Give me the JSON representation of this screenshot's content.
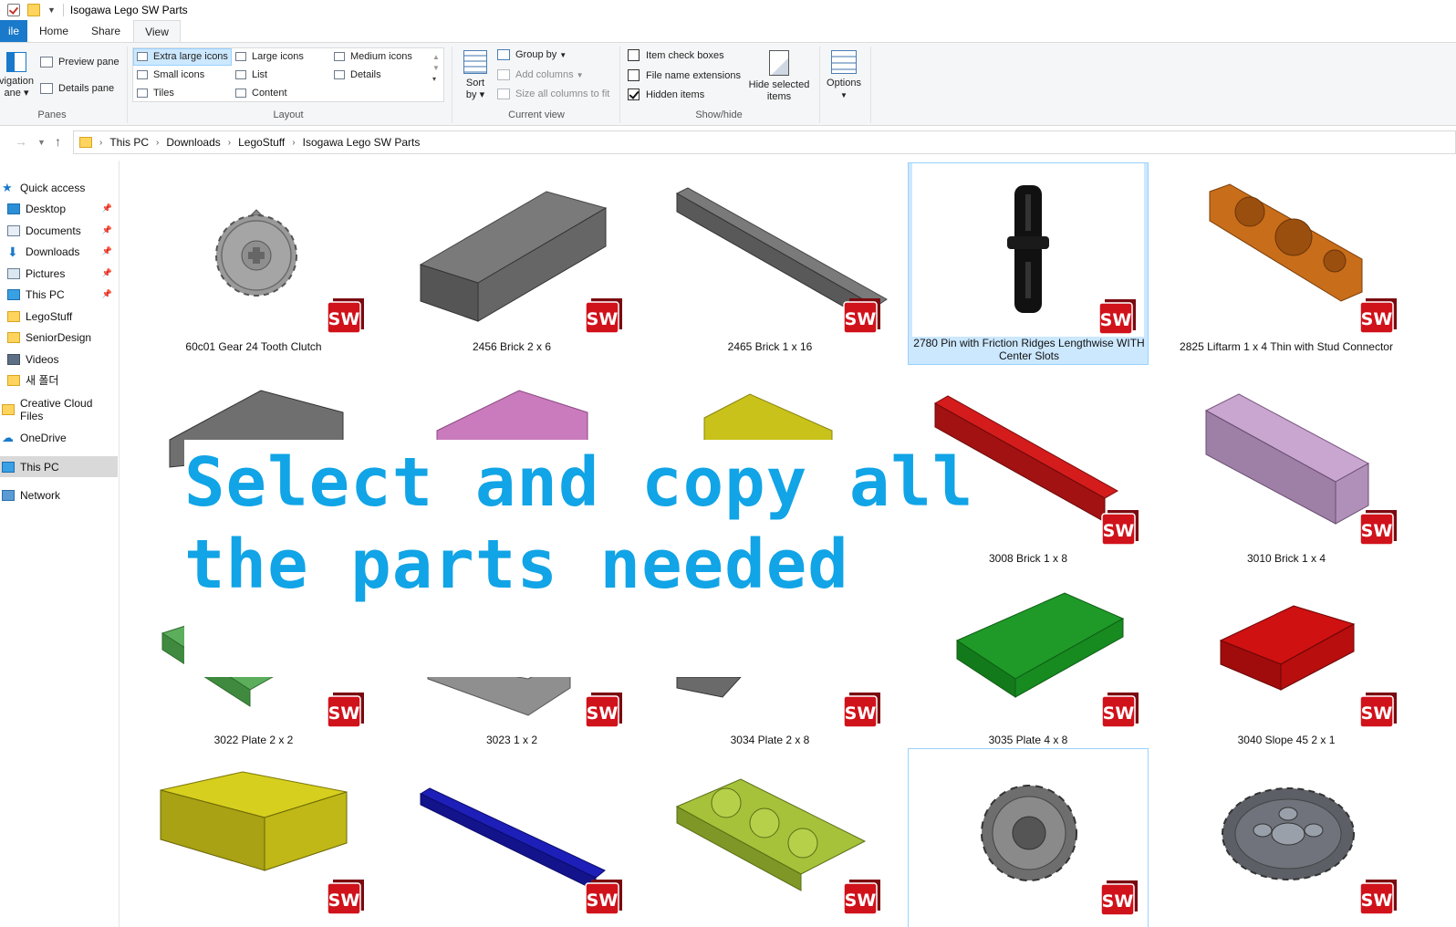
{
  "window": {
    "title": "Isogawa Lego SW Parts"
  },
  "ribbon": {
    "tabs": {
      "file": "ile",
      "home": "Home",
      "share": "Share",
      "view": "View"
    },
    "panes": {
      "nav_pane_line1": "vigation",
      "nav_pane_line2": "ane",
      "preview_pane": "Preview pane",
      "details_pane": "Details pane",
      "label": "Panes"
    },
    "layout": {
      "extra_large_icons": "Extra large icons",
      "large_icons": "Large icons",
      "medium_icons": "Medium icons",
      "small_icons": "Small icons",
      "list": "List",
      "details": "Details",
      "tiles": "Tiles",
      "content": "Content",
      "label": "Layout"
    },
    "current_view": {
      "sort_by_line1": "Sort",
      "sort_by_line2": "by",
      "group_by": "Group by",
      "add_columns": "Add columns",
      "size_columns": "Size all columns to fit",
      "label": "Current view"
    },
    "show_hide": {
      "item_check_boxes": "Item check boxes",
      "item_check_boxes_checked": false,
      "file_name_extensions": "File name extensions",
      "file_name_extensions_checked": false,
      "hidden_items": "Hidden items",
      "hidden_items_checked": true,
      "hide_selected_line1": "Hide selected",
      "hide_selected_line2": "items",
      "label": "Show/hide"
    },
    "options": "Options"
  },
  "address": {
    "crumbs": [
      "This PC",
      "Downloads",
      "LegoStuff",
      "Isogawa Lego SW Parts"
    ]
  },
  "sidebar": {
    "quick_access": "Quick access",
    "desktop": "Desktop",
    "documents": "Documents",
    "downloads": "Downloads",
    "pictures": "Pictures",
    "this_pc_pinned": "This PC",
    "legostuff": "LegoStuff",
    "seniordesign": "SeniorDesign",
    "videos": "Videos",
    "new_folder": "새 폴더",
    "creative_cloud": "Creative Cloud Files",
    "onedrive": "OneDrive",
    "this_pc": "This PC",
    "network": "Network"
  },
  "files": {
    "f1": "60c01 Gear 24 Tooth Clutch",
    "f2": "2456 Brick 2 x 6",
    "f3": "2465 Brick 1 x 16",
    "f4": "2780 Pin with Friction Ridges Lengthwise WITH Center Slots",
    "f5": "2825 Liftarm 1 x 4 Thin with Stud Connector",
    "f9": "3008 Brick 1 x 8",
    "f10": "3010 Brick 1 x 4",
    "f11": "3022 Plate 2 x 2",
    "f12": "3023 1 x 2",
    "f13": "3034 Plate 2 x 8",
    "f14": "3035 Plate 4 x 8",
    "f15": "3040 Slope 45 2 x 1"
  },
  "badge_text": "SW",
  "overlay": {
    "line1": "Select and copy all",
    "line2": "the parts needed"
  },
  "colors": {
    "accent": "#1979ca",
    "selection": "#cce8ff",
    "overlay_text": "#11a4e6",
    "badge_red": "#d0121b"
  }
}
